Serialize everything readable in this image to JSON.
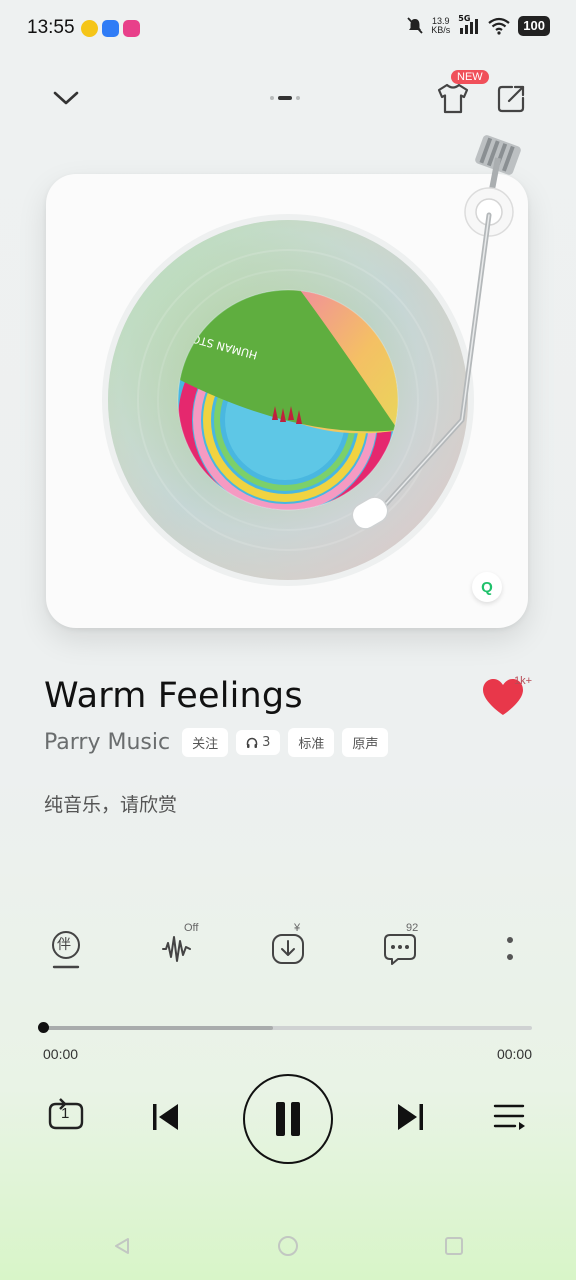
{
  "status_bar": {
    "time": "13:55",
    "net_speed_value": "13.9",
    "net_speed_unit": "KB/s",
    "network": "5G",
    "battery": "100"
  },
  "top_bar": {
    "new_badge": "NEW",
    "page_indicator": {
      "count": 3,
      "active": 1
    }
  },
  "album": {
    "cover_text": "HUMAN STORIES 3",
    "app_badge": "Q"
  },
  "song": {
    "title": "Warm Feelings",
    "artist": "Parry Music",
    "tags": {
      "follow": "关注",
      "listeners": "3",
      "quality": "标准",
      "original": "原声"
    },
    "subtitle": "纯音乐，请欣赏",
    "like_count": "1k+"
  },
  "actions": {
    "accompany_label": "伴",
    "effect_state": "Off",
    "download_price": "¥",
    "comment_count": "92"
  },
  "progress": {
    "current": "00:00",
    "total": "00:00",
    "played_fraction": 0.0,
    "buffered_fraction": 0.47
  },
  "controls": {
    "repeat_mode": "1"
  },
  "colors": {
    "accent_red": "#f0505a",
    "heart": "#e8374a",
    "bottom_gradient": "#d8f5c8"
  }
}
